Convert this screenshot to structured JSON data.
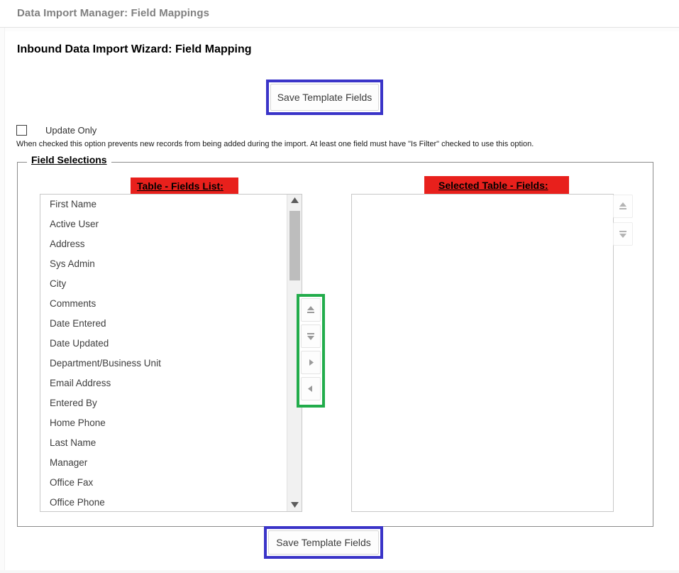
{
  "header": {
    "title": "Data Import Manager: Field Mappings"
  },
  "page": {
    "title": "Inbound Data Import Wizard: Field Mapping"
  },
  "toolbar": {
    "save_top_label": "Save Template Fields",
    "save_bottom_label": "Save Template Fields",
    "highlight_color": "#3a34c8"
  },
  "update_only": {
    "label": "Update Only",
    "checked": false,
    "helper_text": "When checked this option prevents new records from being added during the import. At least one field must have \"Is Filter\" checked to use this option."
  },
  "field_selections": {
    "legend": "Field Selections",
    "left": {
      "caption": "Table - Fields List:",
      "highlight_color": "#e8201c",
      "items": [
        "First Name",
        "Active User",
        "Address",
        "Sys Admin",
        "City",
        "Comments",
        "Date Entered",
        "Date Updated",
        "Department/Business Unit",
        "Email Address",
        "Entered By",
        "Home Phone",
        "Last Name",
        "Manager",
        "Office Fax",
        "Office Phone"
      ]
    },
    "right": {
      "required_marker": "*",
      "caption": "Selected Table - Fields:",
      "highlight_color": "#e8201c",
      "items": []
    },
    "transfer_buttons": {
      "highlight_color": "#22ac4b",
      "move_top_icon": "double-up-arrow-icon",
      "move_bottom_icon": "double-down-arrow-icon",
      "move_right_icon": "right-arrow-icon",
      "move_left_icon": "left-arrow-icon"
    },
    "reorder_buttons": {
      "move_up_icon": "double-up-arrow-icon",
      "move_down_icon": "double-down-arrow-icon"
    },
    "scrollbar": {
      "up_icon": "scroll-up-arrow-icon",
      "down_icon": "scroll-down-arrow-icon"
    }
  }
}
